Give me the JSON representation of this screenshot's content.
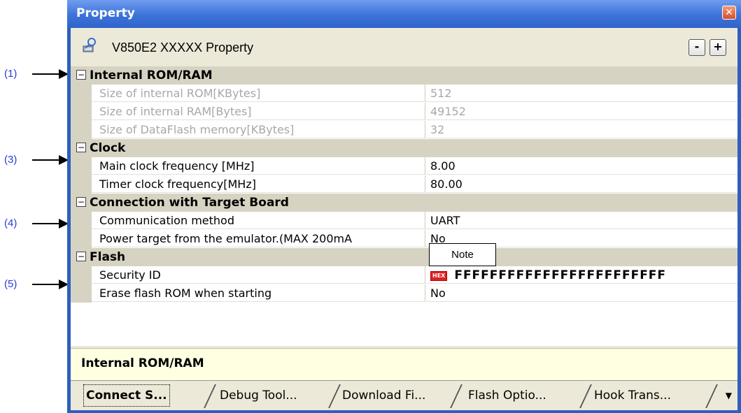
{
  "callouts": [
    "(1)",
    "(3)",
    "(4)",
    "(5)"
  ],
  "window": {
    "title": "Property"
  },
  "header": {
    "title": "V850E2 XXXXX Property",
    "minus": "-",
    "plus": "+"
  },
  "categories": {
    "c1": "Internal ROM/RAM",
    "c2": "Clock",
    "c3": "Connection with Target Board",
    "c4": "Flash"
  },
  "props": [
    {
      "name": "Size of internal ROM[KBytes]",
      "value": "512"
    },
    {
      "name": "Size of internal RAM[Bytes]",
      "value": "49152"
    },
    {
      "name": "Size of DataFlash memory[KBytes]",
      "value": "32"
    },
    {
      "name": "Main clock frequency [MHz]",
      "value": "8.00"
    },
    {
      "name": "Timer clock frequency[MHz]",
      "value": "80.00"
    },
    {
      "name": "Communication method",
      "value": "UART"
    },
    {
      "name": "Power target from the emulator.(MAX 200mA",
      "value": "No"
    },
    {
      "name": "Security ID",
      "badge": "HEX",
      "value": "FFFFFFFFFFFFFFFFFFFFFFFF"
    },
    {
      "name": "Erase flash ROM when starting",
      "value": "No"
    }
  ],
  "note": "Note",
  "description": "Internal ROM/RAM",
  "tabs": [
    "Connect S...",
    "Debug Tool...",
    "Download Fi...",
    "Flash Optio...",
    "Hook Trans..."
  ]
}
